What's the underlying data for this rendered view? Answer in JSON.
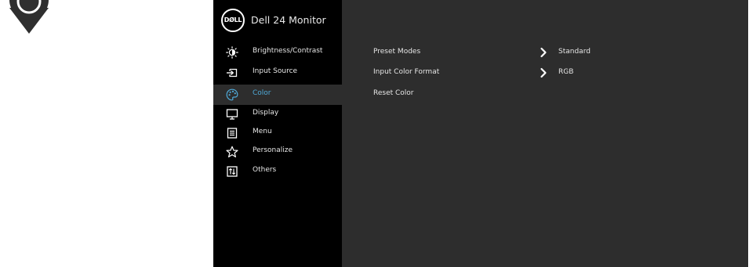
{
  "osd": {
    "title": "Dell 24 Monitor",
    "logo_text": "DØLL",
    "accent_color": "#4fa9d8",
    "panel_color": "#2d2d2d",
    "sidebar_color": "#000000"
  },
  "sidebar": {
    "items": [
      {
        "label": "Brightness/Contrast",
        "icon": "brightness-icon"
      },
      {
        "label": "Input Source",
        "icon": "input-source-icon"
      },
      {
        "label": "Color",
        "icon": "color-palette-icon",
        "active": true
      },
      {
        "label": "Display",
        "icon": "display-icon"
      },
      {
        "label": "Menu",
        "icon": "menu-icon"
      },
      {
        "label": "Personalize",
        "icon": "star-icon"
      },
      {
        "label": "Others",
        "icon": "others-icon"
      }
    ]
  },
  "main": {
    "rows": [
      {
        "label": "Preset Modes",
        "value": "Standard",
        "has_submenu": true
      },
      {
        "label": "Input Color Format",
        "value": "RGB",
        "has_submenu": true
      },
      {
        "label": "Reset Color",
        "value": "",
        "has_submenu": false
      }
    ]
  }
}
